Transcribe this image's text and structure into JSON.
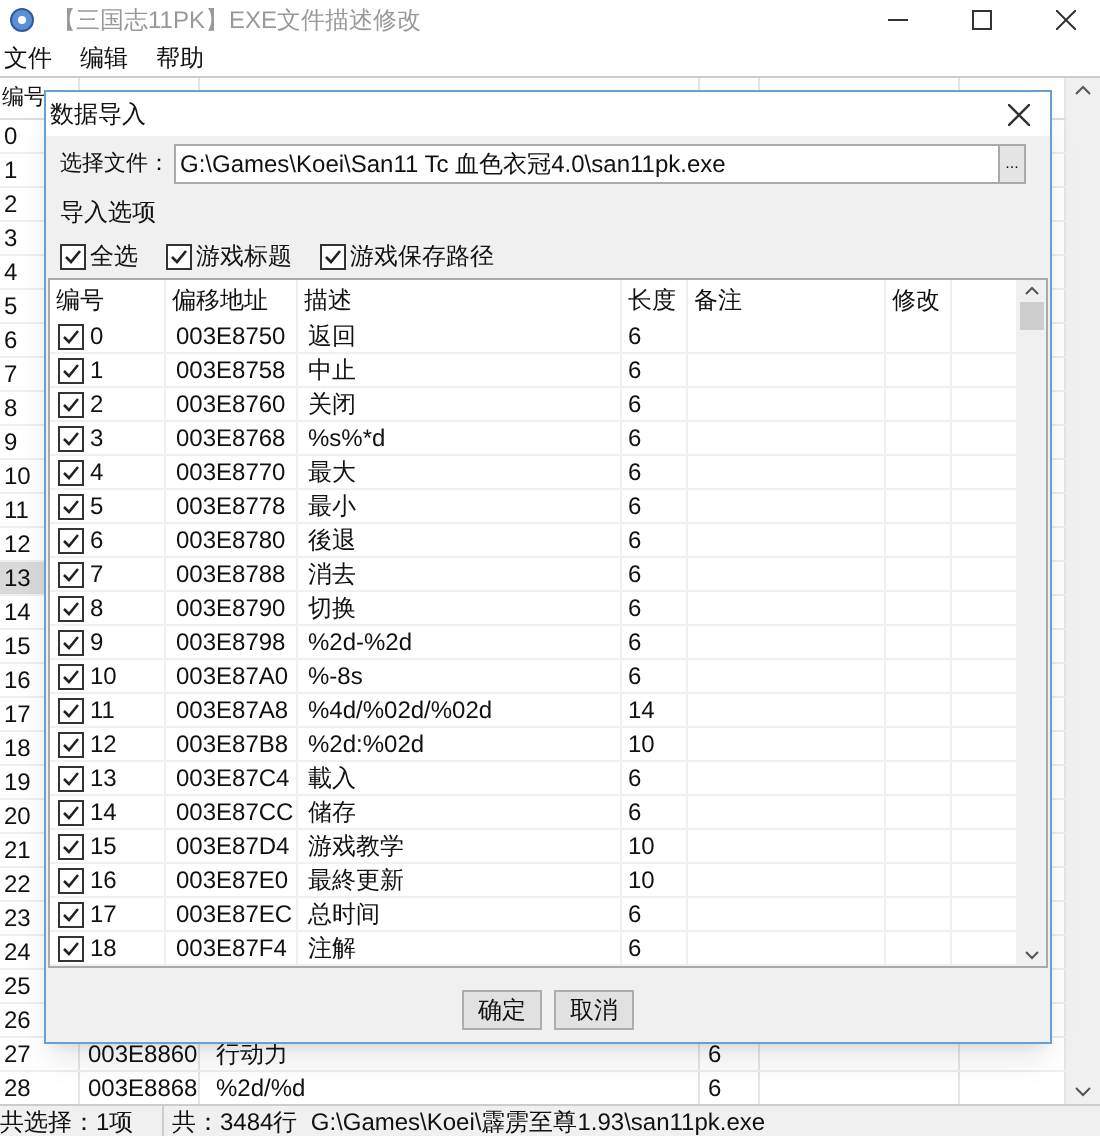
{
  "window": {
    "title": "【三国志11PK】EXE文件描述修改"
  },
  "menu": [
    "文件",
    "编辑",
    "帮助"
  ],
  "table": {
    "columns": [
      "编号"
    ],
    "rows": [
      {
        "number": "0",
        "selected": false
      },
      {
        "number": "1",
        "selected": false
      },
      {
        "number": "2",
        "selected": false
      },
      {
        "number": "3",
        "selected": false
      },
      {
        "number": "4",
        "selected": false
      },
      {
        "number": "5",
        "selected": false
      },
      {
        "number": "6",
        "selected": false
      },
      {
        "number": "7",
        "selected": false
      },
      {
        "number": "8",
        "selected": false
      },
      {
        "number": "9",
        "selected": false
      },
      {
        "number": "10",
        "selected": false
      },
      {
        "number": "11",
        "selected": false
      },
      {
        "number": "12",
        "selected": false
      },
      {
        "number": "13",
        "selected": true
      },
      {
        "number": "14",
        "selected": false
      },
      {
        "number": "15",
        "selected": false
      },
      {
        "number": "16",
        "selected": false
      },
      {
        "number": "17",
        "selected": false
      },
      {
        "number": "18",
        "selected": false
      },
      {
        "number": "19",
        "selected": false
      },
      {
        "number": "20",
        "selected": false
      },
      {
        "number": "21",
        "selected": false
      },
      {
        "number": "22",
        "selected": false
      },
      {
        "number": "23",
        "selected": false
      },
      {
        "number": "24",
        "selected": false
      },
      {
        "number": "25",
        "selected": false
      },
      {
        "number": "26",
        "selected": false
      },
      {
        "number": "27",
        "selected": false,
        "offset": "003E8860",
        "description": "行动力",
        "length": "6"
      },
      {
        "number": "28",
        "selected": false,
        "offset": "003E8868",
        "description": "%2d/%d",
        "length": "6"
      }
    ]
  },
  "status_bar": {
    "selection": "共选择：1项",
    "info": "共：3484行  G:\\Games\\Koei\\霹雳至尊1.93\\san11pk.exe"
  },
  "dialog": {
    "title": "数据导入",
    "file_label": "选择文件：",
    "file_path": "G:\\Games\\Koei\\San11 Tc 血色衣冠4.0\\san11pk.exe",
    "browse_button": "...",
    "options_label": "导入选项",
    "options": [
      {
        "label": "全选",
        "checked": true
      },
      {
        "label": "游戏标题",
        "checked": true
      },
      {
        "label": "游戏保存路径",
        "checked": true
      }
    ],
    "columns": [
      "编号",
      "偏移地址",
      "描述",
      "长度",
      "备注",
      "修改"
    ],
    "rows": [
      {
        "checked": true,
        "number": "0",
        "offset": "003E8750",
        "description": "返回",
        "length": "6"
      },
      {
        "checked": true,
        "number": "1",
        "offset": "003E8758",
        "description": "中止",
        "length": "6"
      },
      {
        "checked": true,
        "number": "2",
        "offset": "003E8760",
        "description": "关闭",
        "length": "6"
      },
      {
        "checked": true,
        "number": "3",
        "offset": "003E8768",
        "description": "%s%*d",
        "length": "6"
      },
      {
        "checked": true,
        "number": "4",
        "offset": "003E8770",
        "description": "最大",
        "length": "6"
      },
      {
        "checked": true,
        "number": "5",
        "offset": "003E8778",
        "description": "最小",
        "length": "6"
      },
      {
        "checked": true,
        "number": "6",
        "offset": "003E8780",
        "description": "後退",
        "length": "6"
      },
      {
        "checked": true,
        "number": "7",
        "offset": "003E8788",
        "description": "消去",
        "length": "6"
      },
      {
        "checked": true,
        "number": "8",
        "offset": "003E8790",
        "description": "切换",
        "length": "6"
      },
      {
        "checked": true,
        "number": "9",
        "offset": "003E8798",
        "description": "%2d-%2d",
        "length": "6"
      },
      {
        "checked": true,
        "number": "10",
        "offset": "003E87A0",
        "description": "%-8s",
        "length": "6"
      },
      {
        "checked": true,
        "number": "11",
        "offset": "003E87A8",
        "description": "%4d/%02d/%02d",
        "length": "14"
      },
      {
        "checked": true,
        "number": "12",
        "offset": "003E87B8",
        "description": "%2d:%02d",
        "length": "10"
      },
      {
        "checked": true,
        "number": "13",
        "offset": "003E87C4",
        "description": "載入",
        "length": "6"
      },
      {
        "checked": true,
        "number": "14",
        "offset": "003E87CC",
        "description": "储存",
        "length": "6"
      },
      {
        "checked": true,
        "number": "15",
        "offset": "003E87D4",
        "description": "游戏教学",
        "length": "10"
      },
      {
        "checked": true,
        "number": "16",
        "offset": "003E87E0",
        "description": "最終更新",
        "length": "10"
      },
      {
        "checked": true,
        "number": "17",
        "offset": "003E87EC",
        "description": "总时间",
        "length": "6"
      },
      {
        "checked": true,
        "number": "18",
        "offset": "003E87F4",
        "description": "注解",
        "length": "6"
      }
    ],
    "buttons": [
      "确定",
      "取消"
    ]
  }
}
